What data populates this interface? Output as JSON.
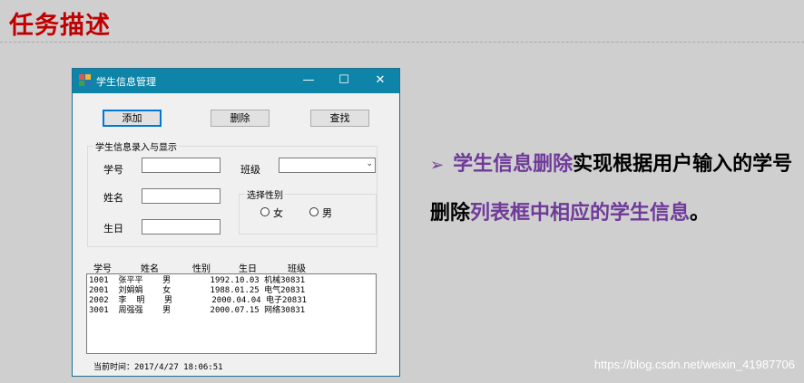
{
  "slide": {
    "title": "任务描述",
    "description": {
      "part1": "学生信息删除",
      "part2": "实现根据用户输入的学号删除",
      "part3": "列表框中相应的学生信息",
      "part4": "。"
    },
    "watermark": "https://blog.csdn.net/weixin_41987706"
  },
  "window": {
    "title": "学生信息管理",
    "controls": {
      "minimize": "—",
      "maximize": "☐",
      "close": "✕"
    },
    "toolbar": {
      "add": "添加",
      "delete": "删除",
      "search": "查找"
    },
    "form": {
      "group_title": "学生信息录入与显示",
      "student_id_label": "学号",
      "name_label": "姓名",
      "birthday_label": "生日",
      "class_label": "班级",
      "gender_group_title": "选择性别",
      "female": "女",
      "male": "男"
    },
    "list": {
      "headers": [
        "学号",
        "姓名",
        "性别",
        "生日",
        "班级"
      ],
      "rows": [
        "1001  张平平    男        1992.10.03 机械30831",
        "2001  刘娟娟    女        1988.01.25 电气20831",
        "2002  李  明    男        2000.04.04 电子20831",
        "3001  周强强    男        2000.07.15 网络30831"
      ]
    },
    "status": "当前时间：2017/4/27 18:06:51"
  },
  "colors": {
    "accent": "#0e85a8",
    "title_red": "#c00000",
    "highlight_purple": "#6f3a9a"
  }
}
